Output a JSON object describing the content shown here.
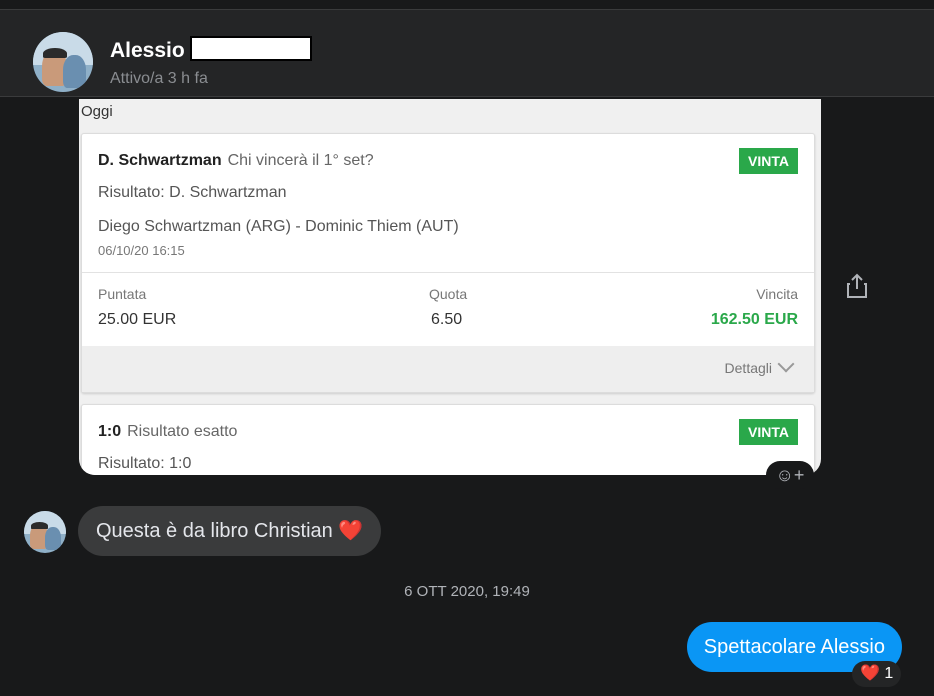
{
  "header": {
    "name": "Alessio",
    "status": "Attivo/a 3 h fa"
  },
  "screenshot": {
    "day_label": "Oggi",
    "card1": {
      "player": "D. Schwartzman",
      "question": "Chi vincerà il 1° set?",
      "badge": "VINTA",
      "result": "Risultato: D. Schwartzman",
      "match": "Diego Schwartzman (ARG) - Dominic Thiem (AUT)",
      "datetime": "06/10/20 16:15",
      "puntata_label": "Puntata",
      "puntata_value": "25.00 EUR",
      "quota_label": "Quota",
      "quota_value": "6.50",
      "vincita_label": "Vincita",
      "vincita_value": "162.50 EUR",
      "details_label": "Dettagli"
    },
    "card2": {
      "score": "1:0",
      "market": "Risultato esatto",
      "badge": "VINTA",
      "result": "Risultato: 1:0"
    }
  },
  "messages": {
    "incoming_text": "Questa è da libro Christian",
    "incoming_emoji": "❤️",
    "timestamp": "6 OTT 2020, 19:49",
    "outgoing_text": "Spettacolare Alessio",
    "reaction_emoji": "❤️",
    "reaction_count": "1"
  },
  "colors": {
    "background": "#18191a",
    "outgoing_bubble": "#0a96f5",
    "incoming_bubble": "#3a3b3c",
    "win_green": "#2aa84a"
  },
  "icons": [
    "share-icon",
    "add-reaction-icon",
    "chevron-down-icon"
  ]
}
